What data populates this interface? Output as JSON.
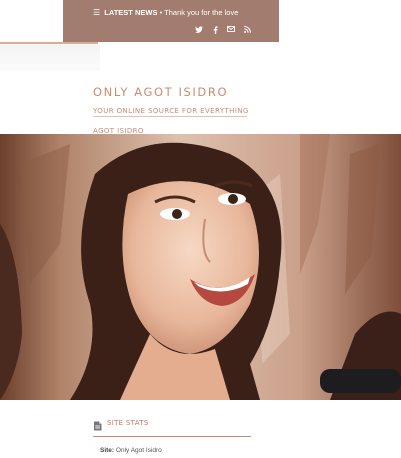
{
  "topbar": {
    "news_label": "LATEST NEWS",
    "news_separator": "•",
    "news_text": "Thank you for the love",
    "social_icons": [
      "twitter-icon",
      "facebook-icon",
      "email-icon",
      "rss-icon"
    ]
  },
  "site": {
    "title": "ONLY AGOT ISIDRO",
    "tagline": "YOUR ONLINE SOURCE FOR EVERYTHING AGOT ISIDRO"
  },
  "stats": {
    "title": "SITE STATS",
    "site_label": "Site:",
    "site_value": "Only Agot Isidro"
  },
  "colors": {
    "topbar": "#a37c70",
    "accent": "#c98b72",
    "line": "#e2a990"
  }
}
